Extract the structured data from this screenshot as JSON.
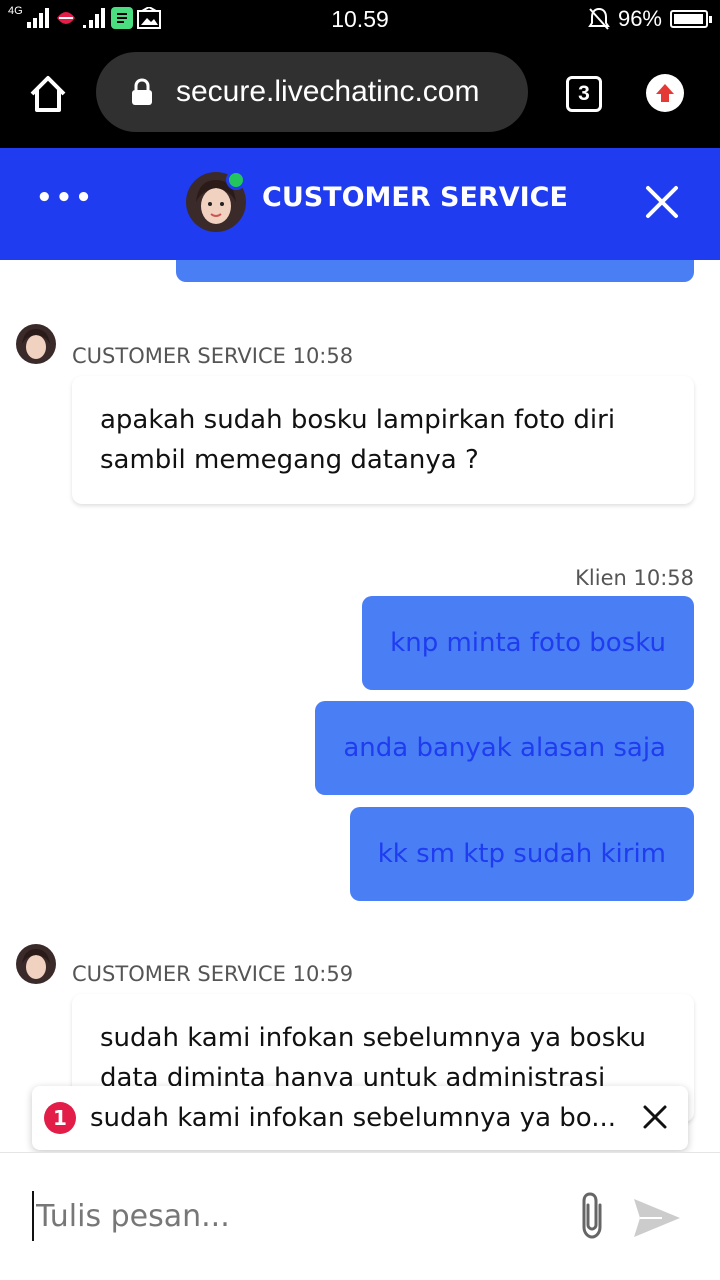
{
  "status_bar": {
    "network_label": "4G",
    "time": "10.59",
    "battery": "96%",
    "battery_level": 0.96
  },
  "browser": {
    "url": "secure.livechatinc.com",
    "tab_count": "3"
  },
  "chat_header": {
    "title": "CUSTOMER SERVICE",
    "online_color": "#22c55e",
    "brand_color": "#1f3cf0"
  },
  "messages": [
    {
      "role": "agent",
      "sender": "CUSTOMER SERVICE 10:58",
      "text": "apakah sudah bosku lampirkan foto diri sambil memegang datanya ?"
    },
    {
      "role": "client",
      "sender": "Klien 10:58",
      "texts": [
        "knp minta foto bosku",
        "anda banyak alasan saja",
        "kk sm ktp sudah kirim"
      ]
    },
    {
      "role": "agent",
      "sender": "CUSTOMER SERVICE 10:59",
      "text": "sudah kami infokan sebelumnya ya bosku data diminta hanya untuk administrasi"
    }
  ],
  "notification": {
    "count": "1",
    "text": "sudah kami infokan sebelumnya ya bo..."
  },
  "composer": {
    "placeholder": "Tulis pesan..."
  }
}
